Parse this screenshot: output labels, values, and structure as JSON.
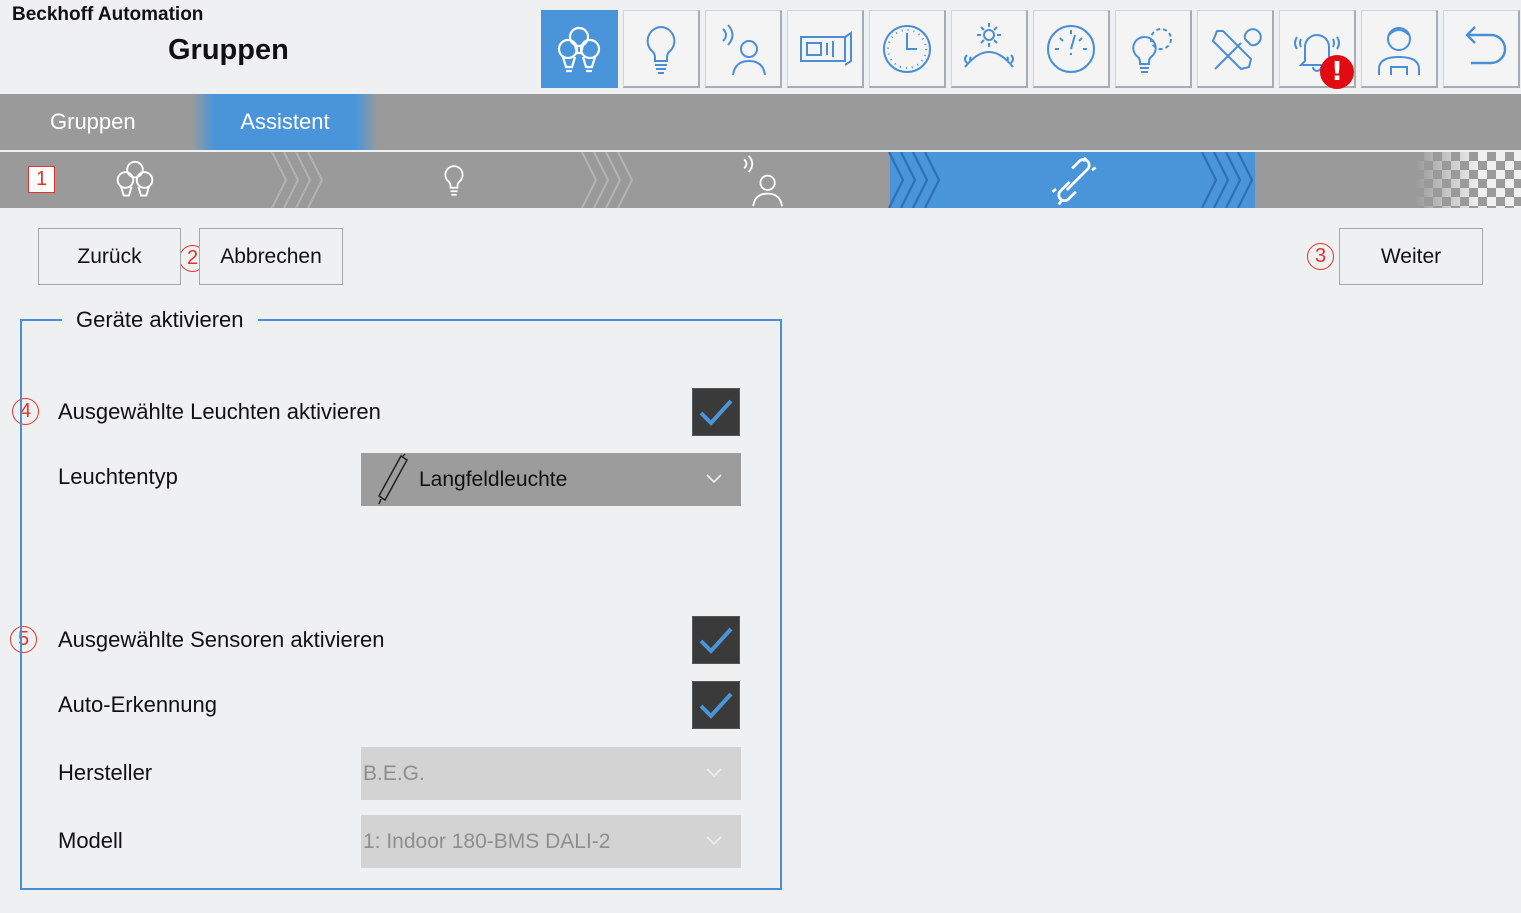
{
  "header": {
    "brand": "Beckhoff Automation",
    "page_title": "Gruppen"
  },
  "toolbar": {
    "buttons": [
      {
        "icon": "groups-icon",
        "active": true
      },
      {
        "icon": "lightbulb-icon"
      },
      {
        "icon": "presence-sensor-icon"
      },
      {
        "icon": "blind-icon"
      },
      {
        "icon": "clock-icon"
      },
      {
        "icon": "daylight-icon"
      },
      {
        "icon": "gauge-icon"
      },
      {
        "icon": "light-settings-icon"
      },
      {
        "icon": "tools-icon"
      },
      {
        "icon": "alarm-bell-icon",
        "badge": "!"
      },
      {
        "icon": "user-icon"
      },
      {
        "icon": "back-icon"
      }
    ]
  },
  "tabs": [
    {
      "label": "Gruppen"
    },
    {
      "label": "Assistent",
      "active": true
    }
  ],
  "stepper": {
    "steps": [
      {
        "icon": "groups-icon"
      },
      {
        "icon": "lightbulb-icon"
      },
      {
        "icon": "presence-sensor-icon"
      },
      {
        "icon": "link-icon",
        "active": true
      }
    ]
  },
  "markers": {
    "m1": "1",
    "m2": "2",
    "m3": "3",
    "m4": "4",
    "m5": "5"
  },
  "actions": {
    "back": "Zurück",
    "cancel": "Abbrechen",
    "next": "Weiter"
  },
  "panel": {
    "legend": "Geräte aktivieren",
    "lights_label": "Ausgewählte Leuchten aktivieren",
    "lights_checked": true,
    "lamp_type_label": "Leuchtentyp",
    "lamp_type_value": "Langfeldleuchte",
    "sensors_label": "Ausgewählte Sensoren aktivieren",
    "sensors_checked": true,
    "auto_detect_label": "Auto-Erkennung",
    "auto_detect_checked": true,
    "manufacturer_label": "Hersteller",
    "manufacturer_value": "B.E.G.",
    "model_label": "Modell",
    "model_value": "1: Indoor 180-BMS DALI-2"
  },
  "colors": {
    "accent": "#4a95d9",
    "bar_gray": "#9a9a9a",
    "alert": "#e10b12",
    "marker": "#e5332a"
  }
}
